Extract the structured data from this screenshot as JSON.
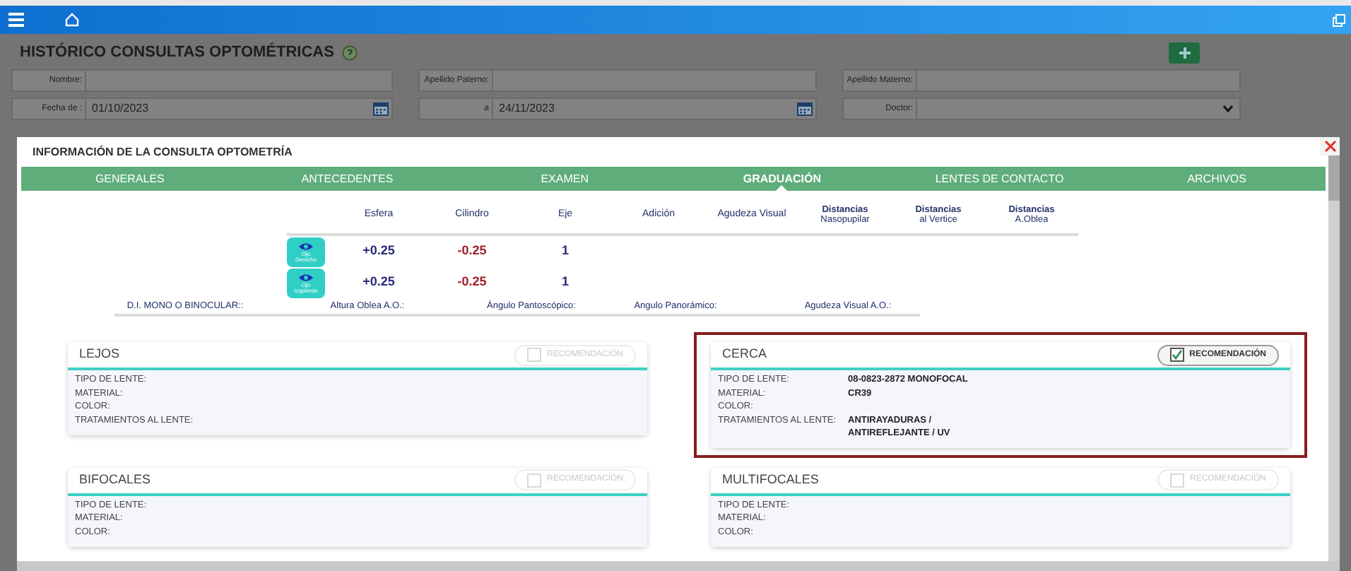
{
  "page": {
    "title": "HISTÓRICO CONSULTAS OPTOMÉTRICAS",
    "filters": [
      {
        "kind": "text",
        "label": "Nombre:"
      },
      {
        "kind": "text",
        "label": "Apellido Paterno:"
      },
      {
        "kind": "text",
        "label": "Apellido Materno:"
      },
      {
        "kind": "date",
        "label": "Fecha de :",
        "value": "01/10/2023"
      },
      {
        "kind": "date",
        "label": "a",
        "value": "24/11/2023"
      },
      {
        "kind": "select",
        "label": "Doctor:"
      }
    ]
  },
  "modal": {
    "title": "INFORMACIÓN DE LA CONSULTA OPTOMETRÍA",
    "tabs": [
      {
        "label": "GENERALES",
        "selected": false
      },
      {
        "label": "ANTECEDENTES",
        "selected": false
      },
      {
        "label": "EXAMEN",
        "selected": false
      },
      {
        "label": "GRADUACIÓN",
        "selected": true
      },
      {
        "label": "LENTES DE CONTACTO",
        "selected": false
      },
      {
        "label": "ARCHIVOS",
        "selected": false
      }
    ],
    "graduation": {
      "columns": [
        {
          "title": "Esfera"
        },
        {
          "title": "Cilindro"
        },
        {
          "title": "Eje"
        },
        {
          "title": "Adición"
        },
        {
          "title": "Agudeza Visual"
        },
        {
          "title": "Distancias",
          "subtitle": "Nasopupilar"
        },
        {
          "title": "Distancias",
          "subtitle": "al Vertice"
        },
        {
          "title": "Distancias",
          "subtitle": "A.Oblea"
        }
      ],
      "rows": [
        {
          "eye": "Ojo Derecho",
          "values": [
            "+0.25",
            "-0.25",
            "1"
          ]
        },
        {
          "eye": "Ojo Izquierdo",
          "values": [
            "+0.25",
            "-0.25",
            "1"
          ]
        }
      ],
      "measures": [
        "D.I. MONO O BINOCULAR::",
        "Altura Oblea A.O.:",
        "Ángulo Pantoscópico:",
        "Angulo Panorámico:",
        "Agudeza Visual A.O.:"
      ]
    },
    "lens_cards": [
      {
        "title": "LEJOS",
        "recommendation": "RECOMENDACIÓN",
        "checked": false,
        "highlighted": false,
        "fields": [
          {
            "label": "TIPO DE LENTE:"
          },
          {
            "label": "MATERIAL:"
          },
          {
            "label": "COLOR:"
          },
          {
            "label": "TRATAMIENTOS AL LENTE:"
          }
        ]
      },
      {
        "title": "CERCA",
        "recommendation": "RECOMENDACIÓN",
        "checked": true,
        "highlighted": true,
        "fields": [
          {
            "label": "TIPO DE LENTE:",
            "value": "08-0823-2872 MONOFOCAL"
          },
          {
            "label": "MATERIAL:",
            "value": "CR39"
          },
          {
            "label": "COLOR:"
          },
          {
            "label": "TRATAMIENTOS AL LENTE:",
            "value": "ANTIRAYADURAS / ANTIREFLEJANTE / UV"
          }
        ]
      },
      {
        "title": "BIFOCALES",
        "recommendation": "RECOMENDACIÓN",
        "checked": false,
        "highlighted": false,
        "fields": [
          {
            "label": "TIPO DE LENTE:"
          },
          {
            "label": "MATERIAL:"
          },
          {
            "label": "COLOR:"
          }
        ]
      },
      {
        "title": "MULTIFOCALES",
        "recommendation": "RECOMENDACIÓN",
        "checked": false,
        "highlighted": false,
        "fields": [
          {
            "label": "TIPO DE LENTE:"
          },
          {
            "label": "MATERIAL:"
          },
          {
            "label": "COLOR:"
          }
        ]
      }
    ]
  }
}
